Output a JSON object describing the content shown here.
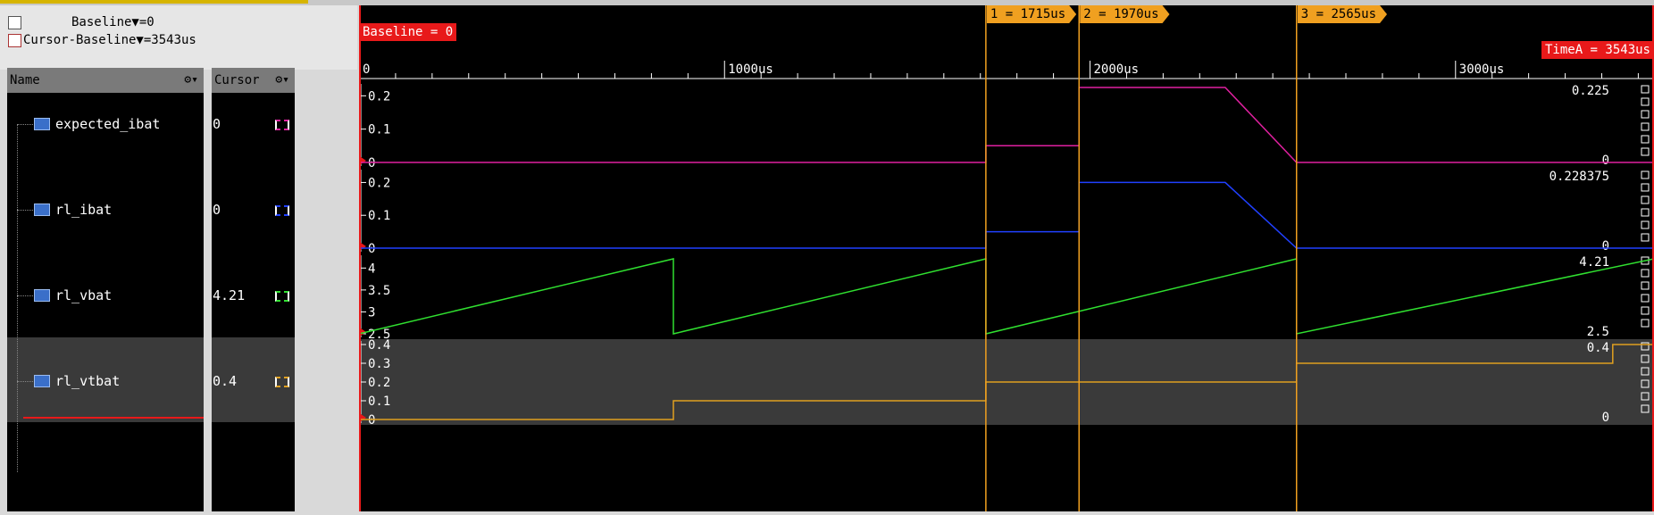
{
  "header": {
    "baseline_line": "Baseline▼=0",
    "cursor_line": "Cursor-Baseline▼=3543us"
  },
  "columns": {
    "name": "Name",
    "cursor": "Cursor"
  },
  "signals": [
    {
      "name": "expected_ibat",
      "cursor_value": "0",
      "color": "#e020a0"
    },
    {
      "name": "rl_ibat",
      "cursor_value": "0",
      "color": "#2040ff"
    },
    {
      "name": "rl_vbat",
      "cursor_value": "4.21",
      "color": "#30e030"
    },
    {
      "name": "rl_vtbat",
      "cursor_value": "0.4",
      "color": "#e0a020"
    }
  ],
  "timeline": {
    "baseline_label": "Baseline = 0",
    "timea_label": "TimeA = 3543us",
    "ticks": [
      "0",
      "1000us",
      "2000us",
      "3000us"
    ],
    "tick_values": [
      0,
      1000,
      2000,
      3000
    ],
    "t_max": 3543,
    "markers": [
      {
        "label": "1 = 1715us",
        "t": 1715
      },
      {
        "label": "2 = 1970us",
        "t": 1970
      },
      {
        "label": "3 = 2565us",
        "t": 2565
      }
    ]
  },
  "lanes": [
    {
      "max_label": "0.225",
      "min_label": "0",
      "y_ticks": [
        "0.2",
        "0.1",
        "0"
      ]
    },
    {
      "max_label": "0.228375",
      "min_label": "0",
      "y_ticks": [
        "0.2",
        "0.1",
        "0"
      ]
    },
    {
      "max_label": "4.21",
      "min_label": "2.5",
      "y_ticks": [
        "4",
        "3.5",
        "3",
        "2.5"
      ]
    },
    {
      "max_label": "0.4",
      "min_label": "0",
      "y_ticks": [
        "0.4",
        "0.3",
        "0.2",
        "0.1",
        "0"
      ]
    }
  ],
  "colors": {
    "marker": "#f0a020",
    "baseline": "#e8191a",
    "grid": "#ffffff"
  }
}
